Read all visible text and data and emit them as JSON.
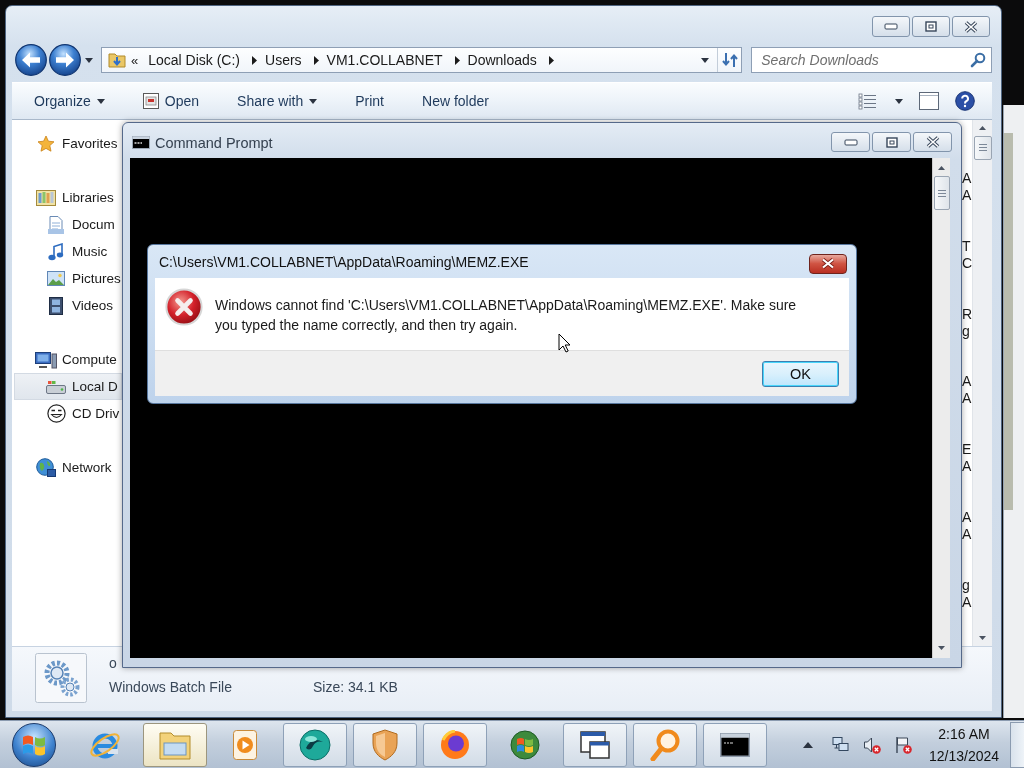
{
  "explorer": {
    "address_bar": {
      "overflow_marker": "«",
      "segments": [
        "Local Disk (C:)",
        "Users",
        "VM1.COLLABNET",
        "Downloads"
      ]
    },
    "search": {
      "placeholder": "Search Downloads"
    },
    "toolbar": [
      {
        "label": "Organize",
        "kind": "menu"
      },
      {
        "label": "Open",
        "kind": "launch"
      },
      {
        "label": "Share with",
        "kind": "menu"
      },
      {
        "label": "Print",
        "kind": "plain"
      },
      {
        "label": "New folder",
        "kind": "plain"
      }
    ],
    "navigation_pane": [
      {
        "label": "Favorites",
        "kind": "favorites",
        "selected": false
      },
      {
        "label": "Libraries",
        "kind": "libraries",
        "selected": false,
        "children": [
          {
            "label": "Docum",
            "kind": "documents",
            "selected": false
          },
          {
            "label": "Music",
            "kind": "music",
            "selected": false
          },
          {
            "label": "Pictures",
            "kind": "pictures",
            "selected": false
          },
          {
            "label": "Videos",
            "kind": "videos",
            "selected": false
          }
        ]
      },
      {
        "label": "Compute",
        "kind": "computer",
        "selected": false,
        "children": [
          {
            "label": "Local D",
            "kind": "drive",
            "selected": true
          },
          {
            "label": "CD Driv",
            "kind": "disc",
            "selected": false
          }
        ]
      },
      {
        "label": "Network",
        "kind": "network",
        "selected": false
      }
    ],
    "file_list": [
      {
        "line_1": "A",
        "line_2": "A"
      },
      {
        "line_1": "T",
        "line_2": "C"
      },
      {
        "line_1": "R",
        "line_2": "g"
      },
      {
        "line_1": "A",
        "line_2": "A"
      },
      {
        "line_1": "E",
        "line_2": "A"
      },
      {
        "line_1": "A",
        "line_2": "A"
      },
      {
        "line_1": "g",
        "line_2": "A"
      }
    ],
    "details_pane": {
      "name": "o",
      "type": "Windows Batch File",
      "size": "Size: 34.1 KB"
    }
  },
  "command_prompt": {
    "title": "Command Prompt"
  },
  "error_dialog": {
    "title": "C:\\Users\\VM1.COLLABNET\\AppData\\Roaming\\MEMZ.EXE",
    "message": "Windows cannot find 'C:\\Users\\VM1.COLLABNET\\AppData\\Roaming\\MEMZ.EXE'. Make sure you typed the name correctly, and then try again.",
    "buttons": [
      {
        "label": "OK",
        "default": true
      }
    ]
  },
  "taskbar": {
    "items": [
      {
        "kind": "ring",
        "running": false,
        "selected": false
      },
      {
        "kind": "folder",
        "running": true,
        "selected": true
      },
      {
        "kind": "player",
        "running": false,
        "selected": false
      },
      {
        "kind": "orb",
        "running": true,
        "selected": false
      },
      {
        "kind": "shield",
        "running": true,
        "selected": false
      },
      {
        "kind": "globe",
        "running": true,
        "selected": false
      },
      {
        "kind": "flag",
        "running": false,
        "selected": false
      },
      {
        "kind": "panes",
        "running": true,
        "selected": false
      },
      {
        "kind": "magnifier",
        "running": true,
        "selected": false
      },
      {
        "kind": "console",
        "running": true,
        "selected": false
      }
    ],
    "tray": [
      {
        "kind": "overflow",
        "alert": false
      },
      {
        "kind": "network",
        "alert": false
      },
      {
        "kind": "volume",
        "alert": true
      },
      {
        "kind": "flag",
        "alert": true
      }
    ],
    "clock": {
      "time": "2:16 AM",
      "date": "12/13/2024"
    }
  }
}
